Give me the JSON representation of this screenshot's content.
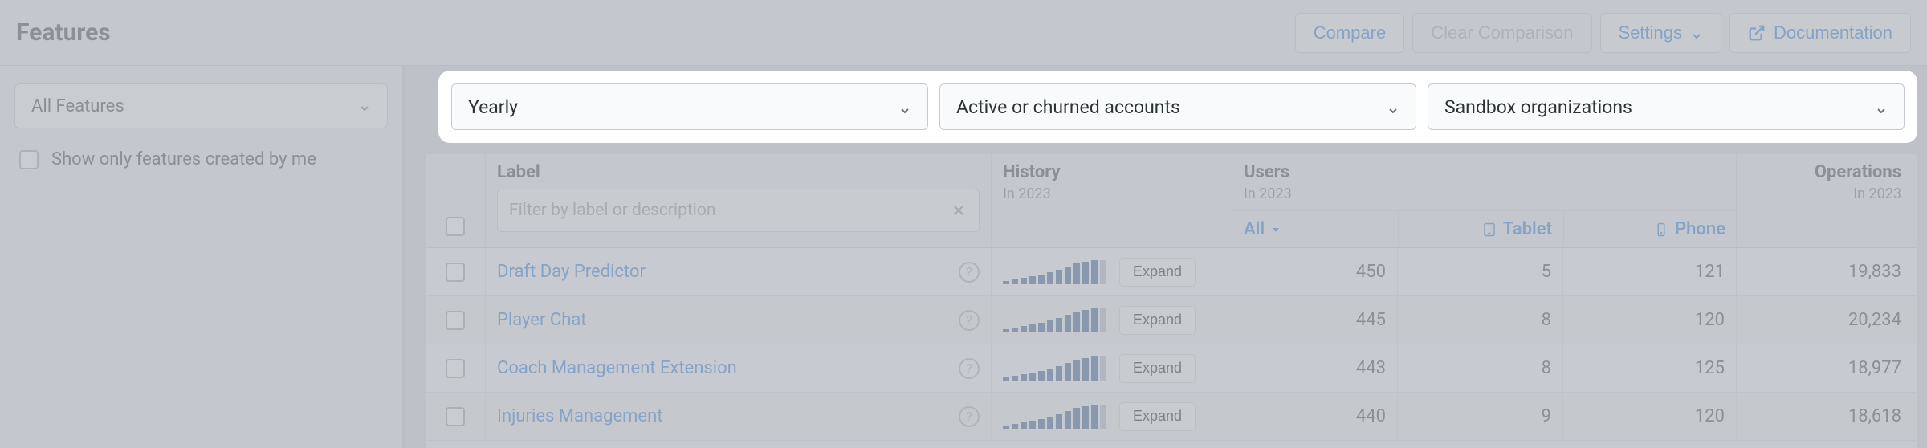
{
  "header": {
    "title": "Features",
    "compare": "Compare",
    "clear": "Clear Comparison",
    "settings": "Settings",
    "docs": "Documentation"
  },
  "sidebar": {
    "all_features": "All Features",
    "show_mine": "Show only features created by me"
  },
  "filters": {
    "period": "Yearly",
    "accounts": "Active or churned accounts",
    "orgs": "Sandbox organizations"
  },
  "columns": {
    "label": "Label",
    "filter_placeholder": "Filter by label or description",
    "history": "History",
    "history_sub": "In 2023",
    "users": "Users",
    "users_sub": "In 2023",
    "all": "All",
    "tablet": "Tablet",
    "phone": "Phone",
    "ops": "Operations",
    "ops_sub": "In 2023"
  },
  "rows": [
    {
      "label": "Draft Day Predictor",
      "all": "450",
      "tablet": "5",
      "phone": "121",
      "ops": "19,833",
      "spark": [
        4,
        6,
        8,
        10,
        12,
        15,
        18,
        22,
        26,
        28,
        30,
        30
      ]
    },
    {
      "label": "Player Chat",
      "all": "445",
      "tablet": "8",
      "phone": "120",
      "ops": "20,234",
      "spark": [
        4,
        6,
        8,
        10,
        12,
        15,
        18,
        22,
        26,
        28,
        30,
        30
      ]
    },
    {
      "label": "Coach Management Extension",
      "all": "443",
      "tablet": "8",
      "phone": "125",
      "ops": "18,977",
      "spark": [
        4,
        6,
        8,
        10,
        12,
        15,
        18,
        22,
        26,
        28,
        30,
        30
      ]
    },
    {
      "label": "Injuries Management",
      "all": "440",
      "tablet": "9",
      "phone": "120",
      "ops": "18,618",
      "spark": [
        4,
        6,
        8,
        10,
        12,
        15,
        18,
        22,
        26,
        28,
        30,
        30
      ]
    }
  ],
  "misc": {
    "expand": "Expand"
  }
}
